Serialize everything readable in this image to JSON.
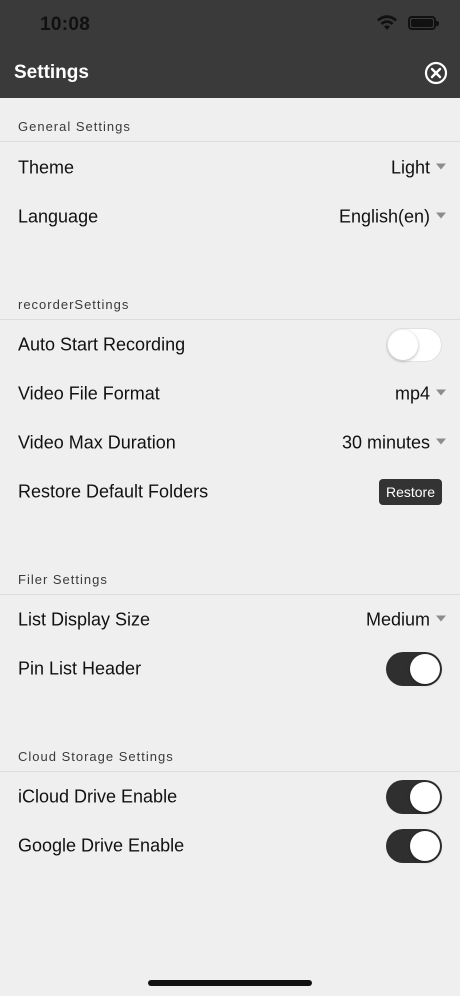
{
  "status_bar": {
    "time": "10:08"
  },
  "header": {
    "title": "Settings"
  },
  "sections": {
    "general": {
      "title": "General Settings",
      "theme": {
        "label": "Theme",
        "value": "Light"
      },
      "language": {
        "label": "Language",
        "value": "English(en)"
      }
    },
    "recorder": {
      "title": "recorderSettings",
      "auto_start": {
        "label": "Auto Start Recording",
        "on": false
      },
      "video_format": {
        "label": "Video File Format",
        "value": "mp4"
      },
      "max_duration": {
        "label": "Video Max Duration",
        "value": "30 minutes"
      },
      "restore_folders": {
        "label": "Restore Default Folders",
        "button": "Restore"
      }
    },
    "filer": {
      "title": "Filer Settings",
      "list_size": {
        "label": "List Display Size",
        "value": "Medium"
      },
      "pin_header": {
        "label": "Pin List Header",
        "on": true
      }
    },
    "cloud": {
      "title": "Cloud Storage Settings",
      "icloud": {
        "label": "iCloud Drive Enable",
        "on": true
      },
      "gdrive": {
        "label": "Google Drive Enable",
        "on": true
      }
    }
  },
  "colors": {
    "header_bg": "#3a3a3a",
    "page_bg": "#efefef",
    "toggle_on": "#2f2f2f"
  }
}
